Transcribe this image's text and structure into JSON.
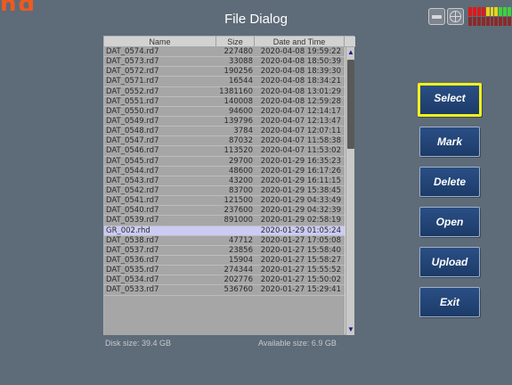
{
  "window": {
    "title": "File Dialog"
  },
  "file_list": {
    "columns": [
      "Name",
      "Size",
      "Date and Time"
    ],
    "rows": [
      {
        "name": "DAT_0574.rd7",
        "size": "227480",
        "date": "2020-04-08 19:59:22"
      },
      {
        "name": "DAT_0573.rd7",
        "size": "33088",
        "date": "2020-04-08 18:50:39"
      },
      {
        "name": "DAT_0572.rd7",
        "size": "190256",
        "date": "2020-04-08 18:39:30"
      },
      {
        "name": "DAT_0571.rd7",
        "size": "16544",
        "date": "2020-04-08 18:34:21"
      },
      {
        "name": "DAT_0552.rd7",
        "size": "1381160",
        "date": "2020-04-08 13:01:29"
      },
      {
        "name": "DAT_0551.rd7",
        "size": "140008",
        "date": "2020-04-08 12:59:28"
      },
      {
        "name": "DAT_0550.rd7",
        "size": "94600",
        "date": "2020-04-07 12:14:17"
      },
      {
        "name": "DAT_0549.rd7",
        "size": "139796",
        "date": "2020-04-07 12:13:47"
      },
      {
        "name": "DAT_0548.rd7",
        "size": "3784",
        "date": "2020-04-07 12:07:11"
      },
      {
        "name": "DAT_0547.rd7",
        "size": "87032",
        "date": "2020-04-07 11:58:38"
      },
      {
        "name": "DAT_0546.rd7",
        "size": "113520",
        "date": "2020-04-07 11:53:02"
      },
      {
        "name": "DAT_0545.rd7",
        "size": "29700",
        "date": "2020-01-29 16:35:23"
      },
      {
        "name": "DAT_0544.rd7",
        "size": "48600",
        "date": "2020-01-29 16:17:26"
      },
      {
        "name": "DAT_0543.rd7",
        "size": "43200",
        "date": "2020-01-29 16:11:15"
      },
      {
        "name": "DAT_0542.rd7",
        "size": "83700",
        "date": "2020-01-29 15:38:45"
      },
      {
        "name": "DAT_0541.rd7",
        "size": "121500",
        "date": "2020-01-29 04:33:49"
      },
      {
        "name": "DAT_0540.rd7",
        "size": "237600",
        "date": "2020-01-29 04:32:39"
      },
      {
        "name": "DAT_0539.rd7",
        "size": "891000",
        "date": "2020-01-29 02:58:19"
      },
      {
        "name": "GR_002.rhd",
        "size": "",
        "date": "2020-01-29 01:05:24"
      },
      {
        "name": "DAT_0538.rd7",
        "size": "47712",
        "date": "2020-01-27 17:05:08"
      },
      {
        "name": "DAT_0537.rd7",
        "size": "23856",
        "date": "2020-01-27 15:58:40"
      },
      {
        "name": "DAT_0536.rd7",
        "size": "15904",
        "date": "2020-01-27 15:58:27"
      },
      {
        "name": "DAT_0535.rd7",
        "size": "274344",
        "date": "2020-01-27 15:55:52"
      },
      {
        "name": "DAT_0534.rd7",
        "size": "202776",
        "date": "2020-01-27 15:50:02"
      },
      {
        "name": "DAT_0533.rd7",
        "size": "536760",
        "date": "2020-01-27 15:29:41"
      }
    ],
    "selected_index": 18
  },
  "footer": {
    "disk_size": "Disk size: 39.4 GB",
    "available_size": "Available size: 6.9 GB"
  },
  "buttons": {
    "select": "Select",
    "mark": "Mark",
    "delete": "Delete",
    "open": "Open",
    "upload": "Upload",
    "exit": "Exit"
  },
  "colors": {
    "background": "#5e6b78",
    "button": "#1f4274",
    "active_border": "#f2f21a",
    "selected_row": "#cbcbf5",
    "list_rows": "#a6a6a6"
  },
  "icons": {
    "drive": "drive-icon",
    "globe": "globe-icon",
    "level": "signal-level-icon"
  }
}
